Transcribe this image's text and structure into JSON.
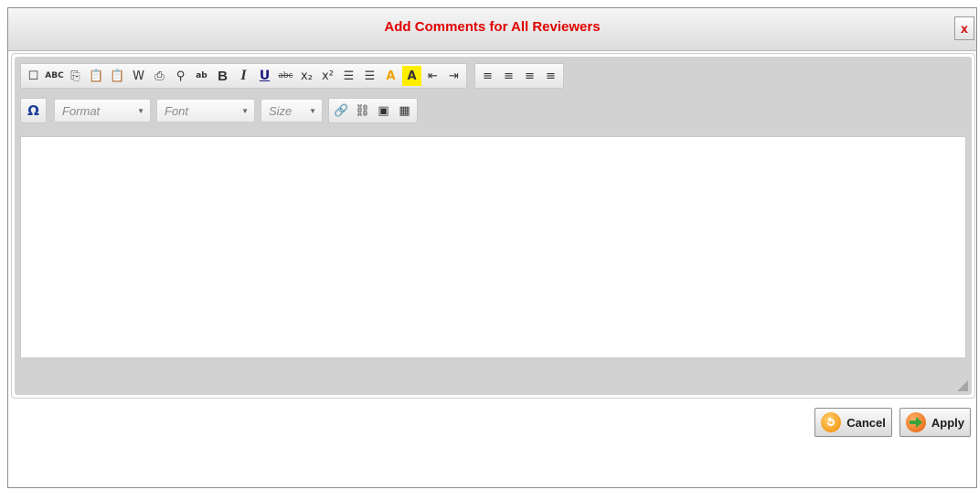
{
  "dialog": {
    "title": "Add Comments for All Reviewers",
    "close_label": "x"
  },
  "toolbar_row1": [
    {
      "name": "new-page-icon",
      "glyph": "☐"
    },
    {
      "name": "spellcheck-icon",
      "glyph": "ABC"
    },
    {
      "name": "copy-icon",
      "glyph": "⎘"
    },
    {
      "name": "paste-icon",
      "glyph": "📋"
    },
    {
      "name": "paste-text-icon",
      "glyph": "📋"
    },
    {
      "name": "paste-word-icon",
      "glyph": "W"
    },
    {
      "name": "print-icon",
      "glyph": "⎙"
    },
    {
      "name": "find-icon",
      "glyph": "⚲"
    },
    {
      "name": "replace-icon",
      "glyph": "ab"
    },
    {
      "name": "bold-icon",
      "glyph": "B"
    },
    {
      "name": "italic-icon",
      "glyph": "I"
    },
    {
      "name": "underline-icon",
      "glyph": "U"
    },
    {
      "name": "strikethrough-icon",
      "glyph": "abc"
    },
    {
      "name": "subscript-icon",
      "glyph": "x₂"
    },
    {
      "name": "superscript-icon",
      "glyph": "x²"
    },
    {
      "name": "numbered-list-icon",
      "glyph": "☰"
    },
    {
      "name": "bulleted-list-icon",
      "glyph": "☰"
    },
    {
      "name": "text-color-icon",
      "glyph": "A"
    },
    {
      "name": "background-color-icon",
      "glyph": "A"
    },
    {
      "name": "outdent-icon",
      "glyph": "⇤"
    },
    {
      "name": "indent-icon",
      "glyph": "⇥"
    }
  ],
  "toolbar_align": [
    {
      "name": "align-left-icon",
      "glyph": "≡"
    },
    {
      "name": "align-center-icon",
      "glyph": "≡"
    },
    {
      "name": "align-right-icon",
      "glyph": "≡"
    },
    {
      "name": "justify-icon",
      "glyph": "≡"
    }
  ],
  "toolbar_row2": {
    "special_char_glyph": "Ω",
    "format_label": "Format",
    "font_label": "Font",
    "size_label": "Size",
    "insert_icons": [
      {
        "name": "insert-link-icon",
        "glyph": "🔗"
      },
      {
        "name": "remove-link-icon",
        "glyph": "⛓"
      },
      {
        "name": "insert-image-icon",
        "glyph": "▣"
      },
      {
        "name": "insert-table-icon",
        "glyph": "▦"
      }
    ]
  },
  "buttons": {
    "cancel_label": "Cancel",
    "apply_label": "Apply"
  },
  "colors": {
    "title": "#e00000",
    "text_color_accent": "#f0a000",
    "bg_color_accent": "#ffee00"
  }
}
